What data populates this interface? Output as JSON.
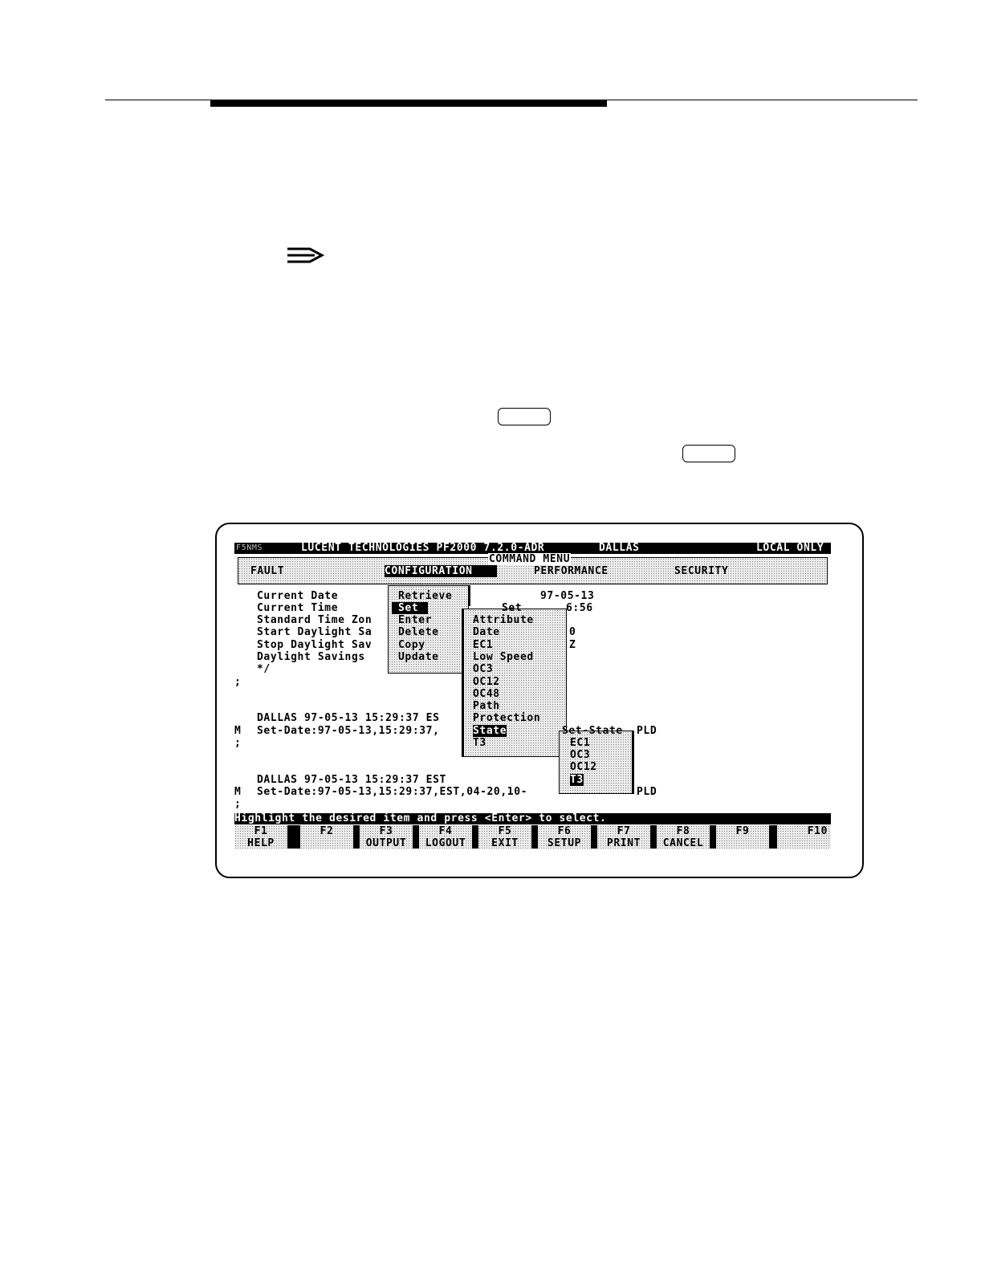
{
  "titlebar": {
    "left_text": "F5NMS",
    "title": "LUCENT TECHNOLOGIES PF2000 7.2.0-ADR",
    "site": "DALLAS",
    "mode": "LOCAL ONLY"
  },
  "command_menu": {
    "label": "COMMAND MENU",
    "items": [
      "FAULT",
      "CONFIGURATION",
      "PERFORMANCE",
      "SECURITY"
    ],
    "selected": "CONFIGURATION"
  },
  "background_lines": [
    "Current Date",
    "Current Time",
    "Standard Time Zon",
    "Start Daylight Sa",
    "Stop Daylight Sav",
    "Daylight Savings",
    "*/"
  ],
  "background_values": [
    "97-05-13",
    "6:56",
    "0",
    "",
    "Z"
  ],
  "prompt_marks": [
    ";",
    "M",
    ";",
    "M",
    ";"
  ],
  "log": {
    "line1": "DALLAS 97-05-13 15:29:37 ES",
    "line2": "Set-Date:97-05-13,15:29:37,",
    "line3": "DALLAS 97-05-13 15:29:37 EST",
    "line4": "Set-Date:97-05-13,15:29:37,EST,04-20,10-",
    "line4_tail": "PLD",
    "line2_tail": "PLD"
  },
  "config_menu": {
    "items": [
      "Retrieve",
      "Set",
      "Enter",
      "Delete",
      "Copy",
      "Update"
    ],
    "selected": "Set"
  },
  "set_menu": {
    "title": "Set",
    "items": [
      "Attribute",
      "Date",
      "EC1",
      "Low Speed",
      "OC3",
      "OC12",
      "OC48",
      "Path",
      "Protection",
      "State",
      "T3"
    ],
    "selected": "State"
  },
  "state_menu": {
    "title": "Set-State",
    "items": [
      "EC1",
      "OC3",
      "OC12",
      "T3"
    ],
    "selected": "T3"
  },
  "status_line": "Highlight the desired item and press <Enter> to select.",
  "function_keys": [
    {
      "key": "F1",
      "label": "HELP"
    },
    {
      "key": "F2",
      "label": ""
    },
    {
      "key": "F3",
      "label": "OUTPUT"
    },
    {
      "key": "F4",
      "label": "LOGOUT"
    },
    {
      "key": "F5",
      "label": "EXIT"
    },
    {
      "key": "F6",
      "label": "SETUP"
    },
    {
      "key": "F7",
      "label": "PRINT"
    },
    {
      "key": "F8",
      "label": "CANCEL"
    },
    {
      "key": "F9",
      "label": ""
    },
    {
      "key": "F10",
      "label": ""
    }
  ]
}
